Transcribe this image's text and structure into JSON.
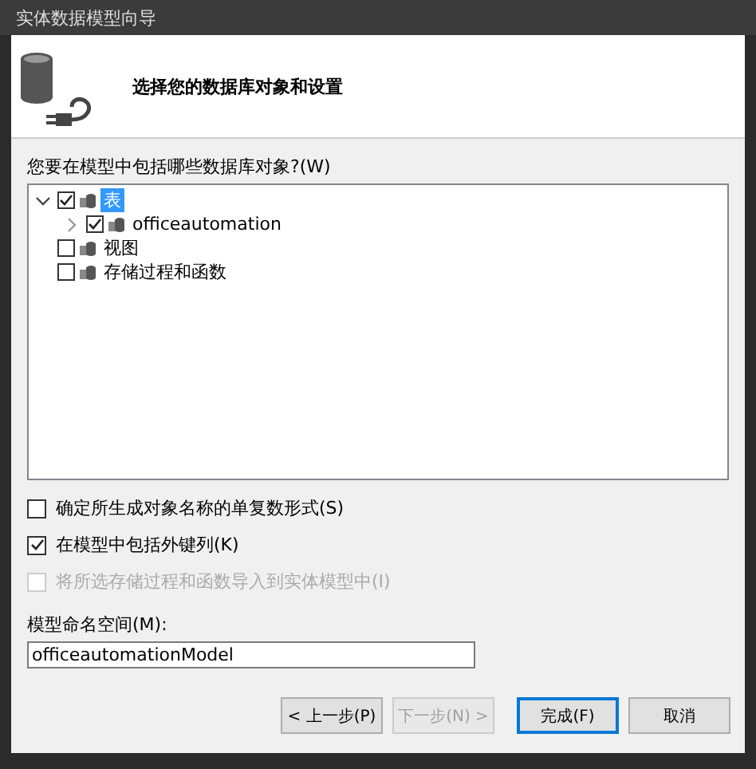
{
  "window": {
    "title": "实体数据模型向导"
  },
  "header": {
    "title": "选择您的数据库对象和设置"
  },
  "objects": {
    "label": "您要在模型中包括哪些数据库对象?(W)",
    "tree": [
      {
        "label": "表",
        "checked": true,
        "expanded": true,
        "selected": true,
        "children": [
          {
            "label": "officeautomation",
            "checked": true,
            "expanded": false,
            "selected": false
          }
        ]
      },
      {
        "label": "视图",
        "checked": false,
        "selected": false
      },
      {
        "label": "存储过程和函数",
        "checked": false,
        "selected": false
      }
    ]
  },
  "options": [
    {
      "label": "确定所生成对象名称的单复数形式(S)",
      "checked": false,
      "disabled": false
    },
    {
      "label": "在模型中包括外键列(K)",
      "checked": true,
      "disabled": false
    },
    {
      "label": "将所选存储过程和函数导入到实体模型中(I)",
      "checked": false,
      "disabled": true
    }
  ],
  "namespace": {
    "label": "模型命名空间(M):",
    "value": "officeautomationModel"
  },
  "buttons": [
    {
      "label": "< 上一步(P)",
      "disabled": false,
      "default": false
    },
    {
      "label": "下一步(N) >",
      "disabled": true,
      "default": false
    },
    {
      "label": "完成(F)",
      "disabled": false,
      "default": true
    },
    {
      "label": "取消",
      "disabled": false,
      "default": false
    }
  ]
}
